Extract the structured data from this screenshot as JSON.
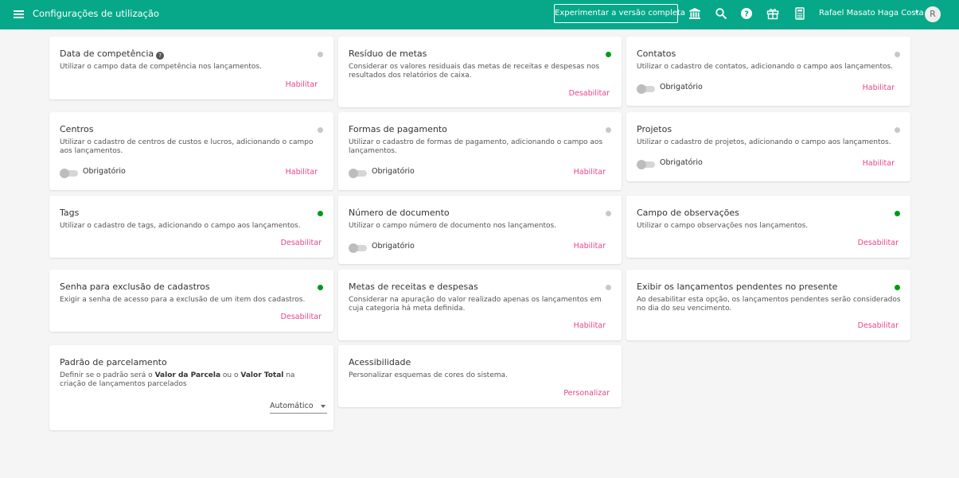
{
  "colors": {
    "topbar": "#06a889",
    "enabled_dot": "#009a1b",
    "disabled_dot": "#c8c8c8",
    "link": "#e9448d"
  },
  "topbar": {
    "menu_icon": "hamburger-menu-icon",
    "title": "Configurações de utilização",
    "trial_button": "Experimentar a versão completa",
    "icons": [
      "bank-icon",
      "search-icon",
      "help-icon",
      "gift-icon",
      "calculator-icon"
    ],
    "user_name": "Rafael Masato Haga Costa",
    "user_caret": "▾",
    "avatar_letter": "R"
  },
  "common": {
    "required_label": "Obrigatório",
    "help_glyph": "?"
  },
  "cards": {
    "competencia": {
      "title": "Data de competência",
      "desc": "Utilizar o campo data de competência nos lançamentos.",
      "action": "Habilitar",
      "enabled": false
    },
    "residuo": {
      "title": "Resíduo de metas",
      "desc": "Considerar os valores residuais das metas de receitas e despesas nos resultados dos relatórios de caixa.",
      "action": "Desabilitar",
      "enabled": true
    },
    "contatos": {
      "title": "Contatos",
      "desc": "Utilizar o cadastro de contatos, adicionando o campo aos lançamentos.",
      "action": "Habilitar",
      "enabled": false,
      "required": false
    },
    "centros": {
      "title": "Centros",
      "desc": "Utilizar o cadastro de centros de custos e lucros, adicionando o campo aos lançamentos.",
      "action": "Habilitar",
      "enabled": false,
      "required": false
    },
    "formas": {
      "title": "Formas de pagamento",
      "desc": "Utilizar o cadastro de formas de pagamento, adicionando o campo aos lançamentos.",
      "action": "Habilitar",
      "enabled": false,
      "required": false
    },
    "projetos": {
      "title": "Projetos",
      "desc": "Utilizar o cadastro de projetos, adicionando o campo aos lançamentos.",
      "action": "Habilitar",
      "enabled": false,
      "required": false
    },
    "tags": {
      "title": "Tags",
      "desc": "Utilizar o cadastro de tags, adicionando o campo aos lançamentos.",
      "action": "Desabilitar",
      "enabled": true
    },
    "numero": {
      "title": "Número de documento",
      "desc": "Utilizar o campo número de documento nos lançamentos.",
      "action": "Habilitar",
      "enabled": false,
      "required": false
    },
    "observacoes": {
      "title": "Campo de observações",
      "desc": "Utilizar o campo observações nos lançamentos.",
      "action": "Desabilitar",
      "enabled": true
    },
    "senha": {
      "title": "Senha para exclusão de cadastros",
      "desc": "Exigir a senha de acesso para a exclusão de um item dos cadastros.",
      "action": "Desabilitar",
      "enabled": true
    },
    "metas": {
      "title": "Metas de receitas e despesas",
      "desc": "Considerar na apuração do valor realizado apenas os lançamentos em cuja categoria há meta definida.",
      "action": "Habilitar",
      "enabled": false
    },
    "pendentes": {
      "title": "Exibir os lançamentos pendentes no presente",
      "desc": "Ao desabilitar esta opção, os lançamentos pendentes serão considerados no dia do seu vencimento.",
      "action": "Desabilitar",
      "enabled": true
    },
    "parcelamento": {
      "title": "Padrão de parcelamento",
      "desc_1": "Definir se o padrão será o ",
      "desc_bold_1": "Valor da Parcela",
      "desc_2": " ou o ",
      "desc_bold_2": "Valor Total",
      "desc_3": " na criação de lançamentos parcelados",
      "select_value": "Automático"
    },
    "acessibilidade": {
      "title": "Acessibilidade",
      "desc": "Personalizar esquemas de cores do sistema.",
      "action": "Personalizar"
    }
  }
}
